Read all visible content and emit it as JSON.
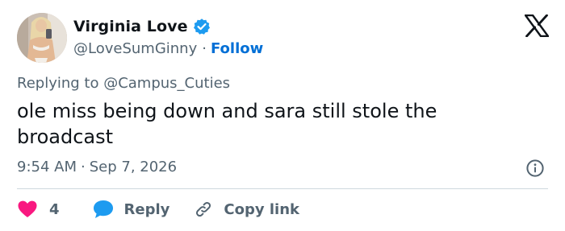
{
  "author": {
    "display_name": "Virginia Love",
    "handle": "@LoveSumGinny",
    "separator": "·",
    "follow_label": "Follow",
    "verified_color": "#1d9bf0"
  },
  "reply": {
    "label": "Replying to @Campus_Cuties"
  },
  "tweet": {
    "text": "ole miss being down and sara still stole the broadcast",
    "time": "9:54 AM",
    "separator": "·",
    "date": "Sep 7, 2026"
  },
  "actions": {
    "like_count": "4",
    "reply_label": "Reply",
    "copy_link_label": "Copy link"
  },
  "icons": {
    "brand": "x-logo-icon",
    "info": "info-icon",
    "like": "heart-icon",
    "reply": "speech-bubble-icon",
    "copy": "link-icon"
  },
  "colors": {
    "like": "#f91880",
    "reply": "#1d9bf0",
    "follow": "#006fd6",
    "secondary_text": "#536471"
  }
}
